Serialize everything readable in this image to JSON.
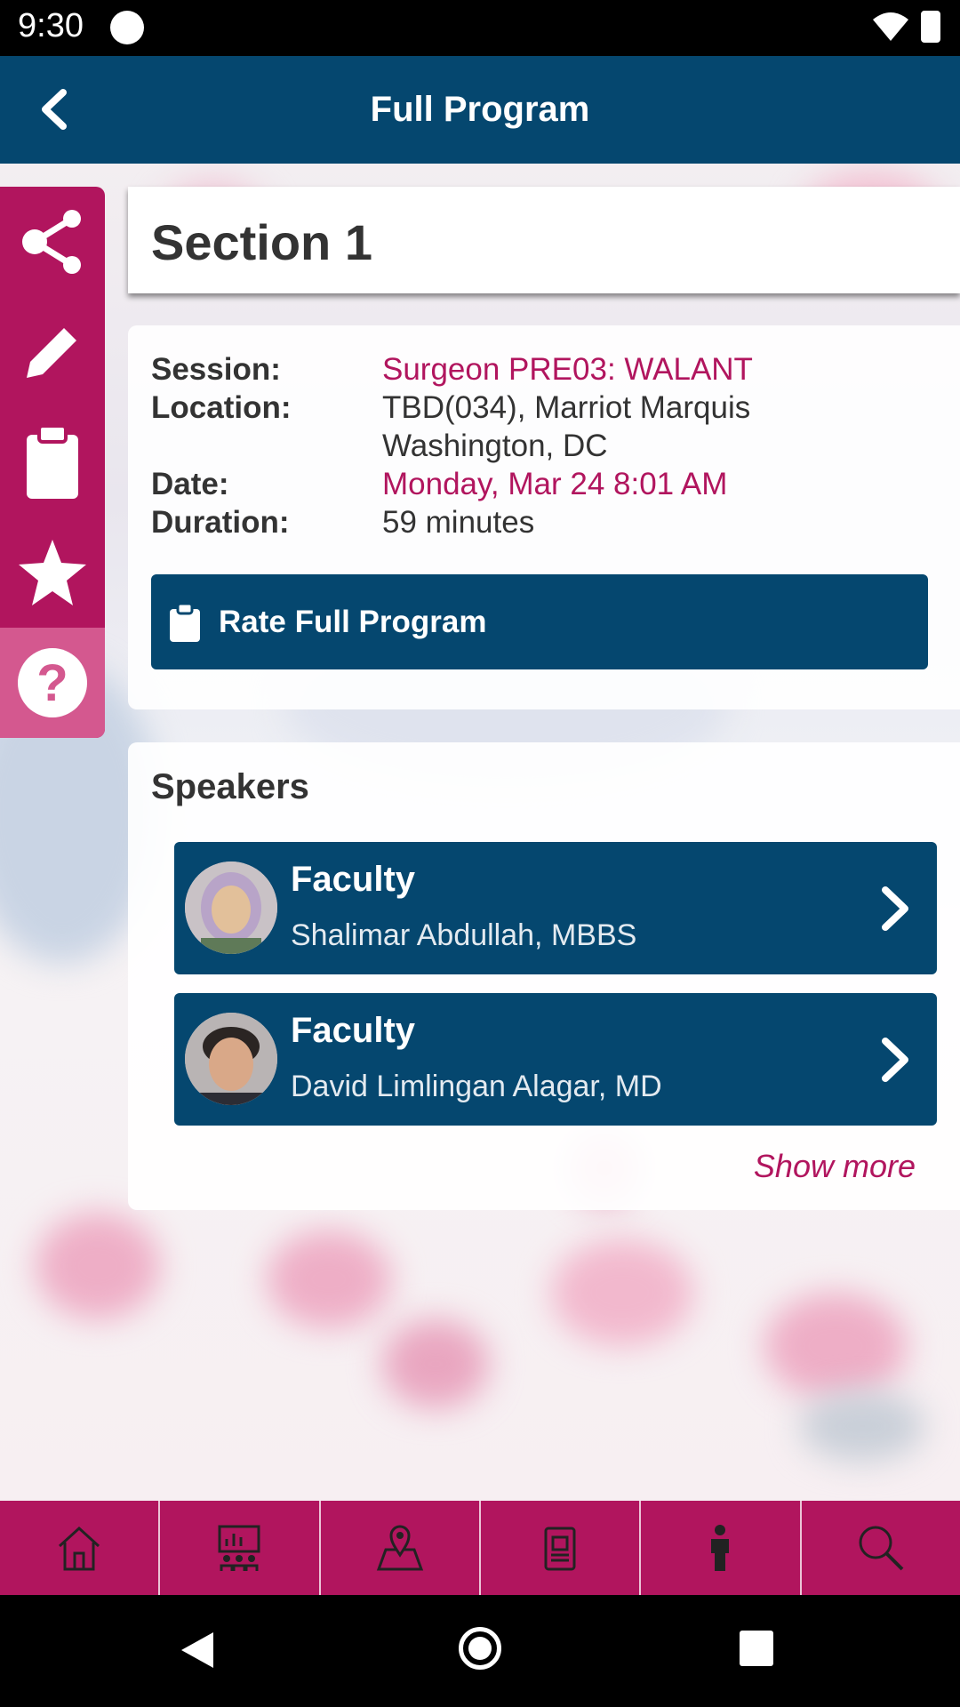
{
  "status_bar": {
    "time": "9:30"
  },
  "app_bar": {
    "title": "Full Program",
    "back_icon": "chevron-left-icon"
  },
  "side_rail": {
    "items": [
      {
        "icon": "share-icon"
      },
      {
        "icon": "pencil-icon"
      },
      {
        "icon": "clipboard-icon"
      },
      {
        "icon": "star-icon"
      },
      {
        "icon": "help-icon",
        "glyph": "?"
      }
    ]
  },
  "section": {
    "title": "Section 1"
  },
  "details": {
    "session_label": "Session:",
    "session_value": "Surgeon PRE03: WALANT",
    "location_label": "Location:",
    "location_value": "TBD(034), Marriot Marquis Washington, DC",
    "date_label": "Date:",
    "date_value": "Monday, Mar 24 8:01 AM",
    "duration_label": "Duration:",
    "duration_value": "59 minutes",
    "rate_button": "Rate Full Program"
  },
  "speakers": {
    "title": "Speakers",
    "items": [
      {
        "role": "Faculty",
        "name": "Shalimar Abdullah, MBBS"
      },
      {
        "role": "Faculty",
        "name": "David Limlingan Alagar, MD"
      }
    ],
    "show_more": "Show more"
  },
  "bottom_nav": {
    "items": [
      {
        "icon": "home-icon"
      },
      {
        "icon": "presentation-icon"
      },
      {
        "icon": "map-icon"
      },
      {
        "icon": "badge-icon"
      },
      {
        "icon": "person-icon"
      },
      {
        "icon": "search-icon"
      }
    ]
  },
  "colors": {
    "primary": "#05476f",
    "accent": "#b1155e",
    "accent_light": "#d4588f"
  }
}
